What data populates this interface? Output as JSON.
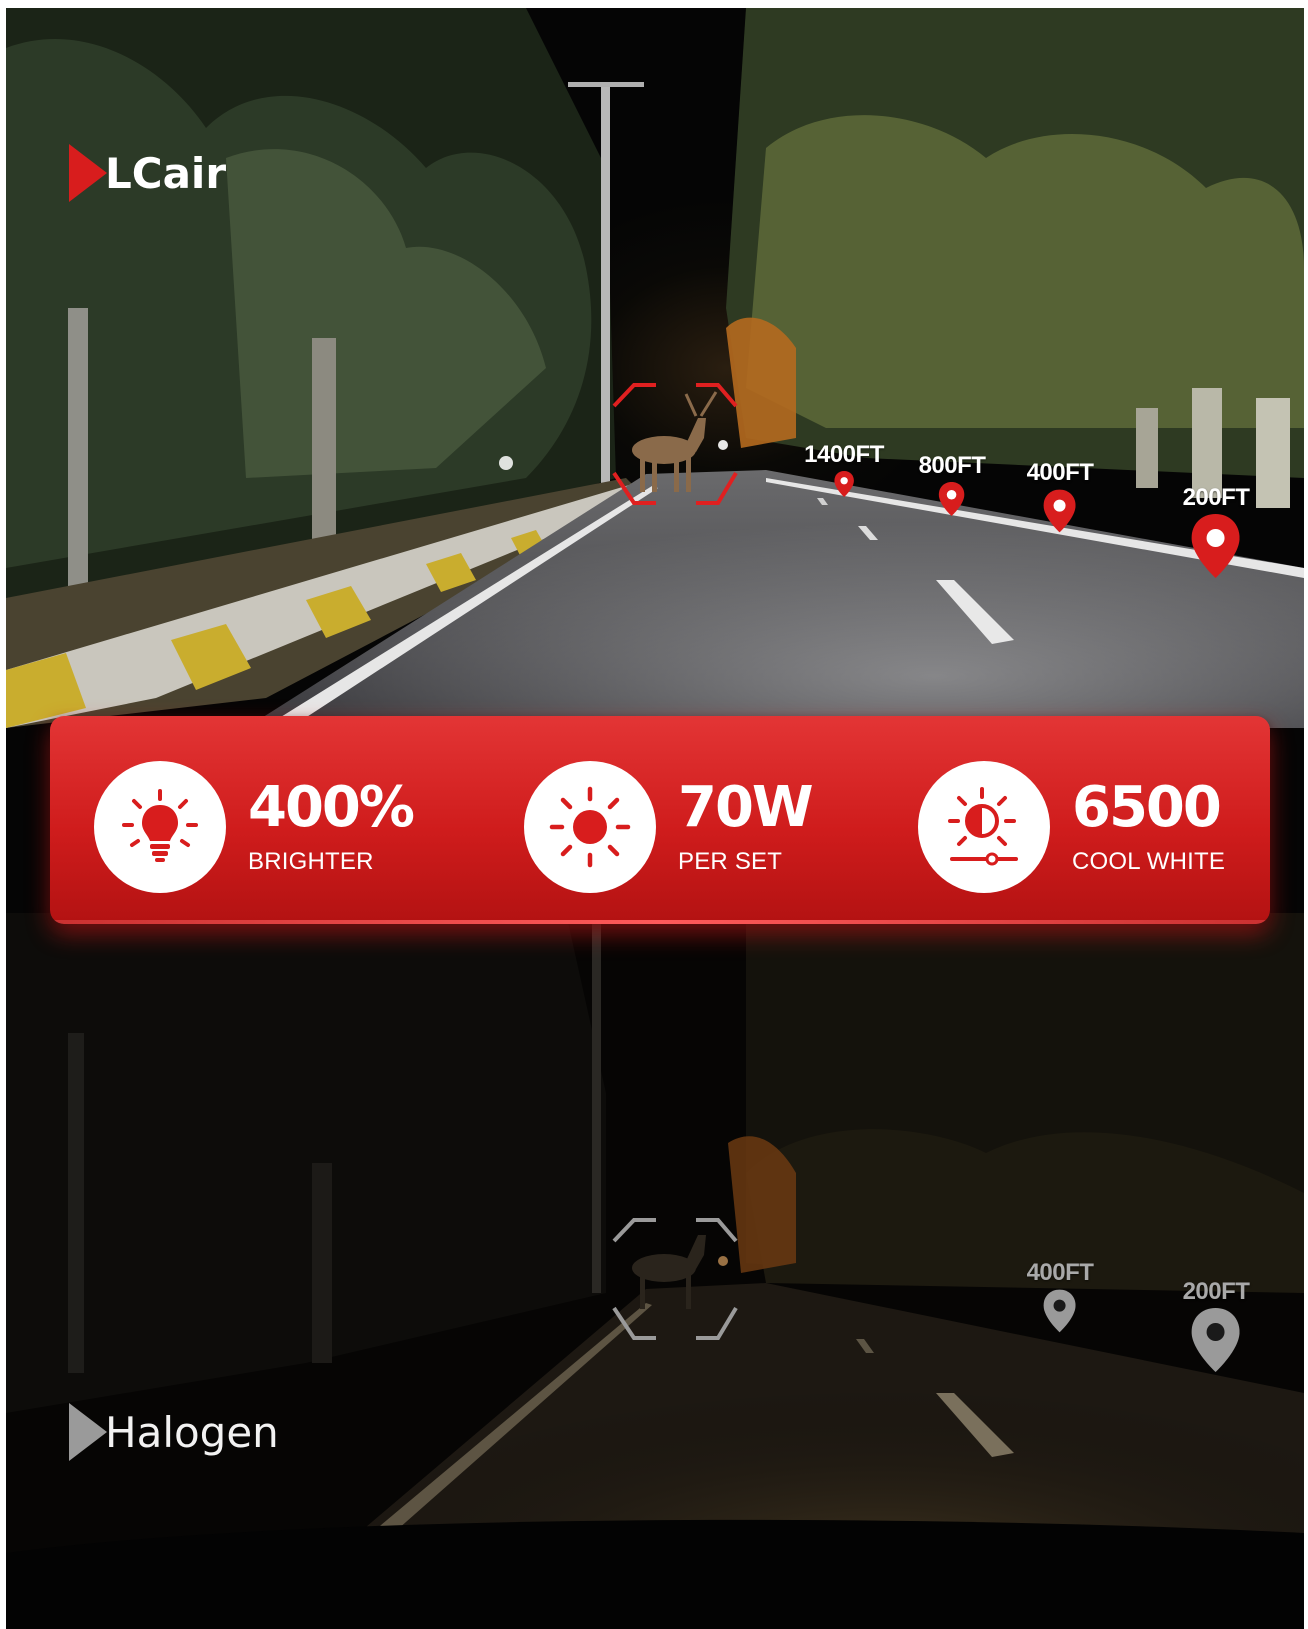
{
  "led_view": {
    "brand": "LCair",
    "distance_markers": [
      "1400FT",
      "800FT",
      "400FT",
      "200FT"
    ]
  },
  "features": [
    {
      "value": "400%",
      "label": "BRIGHTER",
      "icon": "bulb-icon"
    },
    {
      "value": "70W",
      "label": "PER SET",
      "icon": "sun-icon"
    },
    {
      "value": "6500",
      "label": "COOL WHITE",
      "icon": "color-temperature-icon"
    }
  ],
  "halogen_view": {
    "label": "Halogen",
    "distance_markers": [
      "400FT",
      "200FT"
    ]
  },
  "colors": {
    "accent_red": "#d81d1d",
    "halogen_gray": "#9a9a9a"
  }
}
